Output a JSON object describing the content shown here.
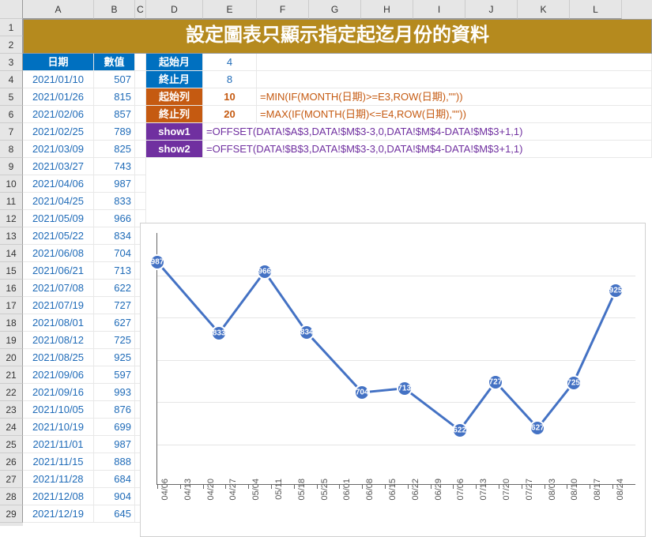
{
  "columns": [
    "A",
    "B",
    "C",
    "D",
    "E",
    "F",
    "G",
    "H",
    "I",
    "J",
    "K",
    "L"
  ],
  "title": "設定圖表只顯示指定起迄月份的資料",
  "table_header": {
    "date": "日期",
    "value": "數值"
  },
  "table_rows": [
    {
      "date": "2021/01/10",
      "value": 507
    },
    {
      "date": "2021/01/26",
      "value": 815
    },
    {
      "date": "2021/02/06",
      "value": 857
    },
    {
      "date": "2021/02/25",
      "value": 789
    },
    {
      "date": "2021/03/09",
      "value": 825
    },
    {
      "date": "2021/03/27",
      "value": 743
    },
    {
      "date": "2021/04/06",
      "value": 987
    },
    {
      "date": "2021/04/25",
      "value": 833
    },
    {
      "date": "2021/05/09",
      "value": 966
    },
    {
      "date": "2021/05/22",
      "value": 834
    },
    {
      "date": "2021/06/08",
      "value": 704
    },
    {
      "date": "2021/06/21",
      "value": 713
    },
    {
      "date": "2021/07/08",
      "value": 622
    },
    {
      "date": "2021/07/19",
      "value": 727
    },
    {
      "date": "2021/08/01",
      "value": 627
    },
    {
      "date": "2021/08/12",
      "value": 725
    },
    {
      "date": "2021/08/25",
      "value": 925
    },
    {
      "date": "2021/09/06",
      "value": 597
    },
    {
      "date": "2021/09/16",
      "value": 993
    },
    {
      "date": "2021/10/05",
      "value": 876
    },
    {
      "date": "2021/10/19",
      "value": 699
    },
    {
      "date": "2021/11/01",
      "value": 987
    },
    {
      "date": "2021/11/15",
      "value": 888
    },
    {
      "date": "2021/11/28",
      "value": 684
    },
    {
      "date": "2021/12/08",
      "value": 904
    },
    {
      "date": "2021/12/19",
      "value": 645
    }
  ],
  "params": [
    {
      "label": "起始月",
      "cls": "hdr-blue",
      "value": "4",
      "vcls": "val-blue",
      "formula": ""
    },
    {
      "label": "終止月",
      "cls": "hdr-blue",
      "value": "8",
      "vcls": "val-blue",
      "formula": ""
    },
    {
      "label": "起始列",
      "cls": "hdr-orange",
      "value": "10",
      "vcls": "val-o",
      "formula": "=MIN(IF(MONTH(日期)>=E3,ROW(日期),\"\"))"
    },
    {
      "label": "終止列",
      "cls": "hdr-orange",
      "value": "20",
      "vcls": "val-o",
      "formula": "=MAX(IF(MONTH(日期)<=E4,ROW(日期),\"\"))"
    },
    {
      "label": "show1",
      "cls": "hdr-purple",
      "value": "",
      "vcls": "",
      "formula": "=OFFSET(DATA!$A$3,DATA!$M$3-3,0,DATA!$M$4-DATA!$M$3+1,1)"
    },
    {
      "label": "show2",
      "cls": "hdr-purple",
      "value": "",
      "vcls": "",
      "formula": "=OFFSET(DATA!$B$3,DATA!$M$3-3,0,DATA!$M$4-DATA!$M$3+1,1)"
    }
  ],
  "chart_data": {
    "type": "line",
    "title": "",
    "categories": [
      "04/06",
      "04/13",
      "04/20",
      "04/27",
      "05/04",
      "05/11",
      "05/18",
      "05/25",
      "06/01",
      "06/08",
      "06/15",
      "06/22",
      "06/29",
      "07/06",
      "07/13",
      "07/20",
      "07/27",
      "08/03",
      "08/10",
      "08/17",
      "08/24"
    ],
    "points": [
      {
        "x": "04/06",
        "y": 987
      },
      {
        "x": "04/25",
        "y": 833
      },
      {
        "x": "05/09",
        "y": 966
      },
      {
        "x": "05/22",
        "y": 834
      },
      {
        "x": "06/08",
        "y": 704
      },
      {
        "x": "06/21",
        "y": 713
      },
      {
        "x": "07/08",
        "y": 622
      },
      {
        "x": "07/19",
        "y": 727
      },
      {
        "x": "08/01",
        "y": 627
      },
      {
        "x": "08/12",
        "y": 725
      },
      {
        "x": "08/25",
        "y": 925
      }
    ],
    "ylim": [
      500,
      1050
    ],
    "xlabel": "",
    "ylabel": ""
  }
}
